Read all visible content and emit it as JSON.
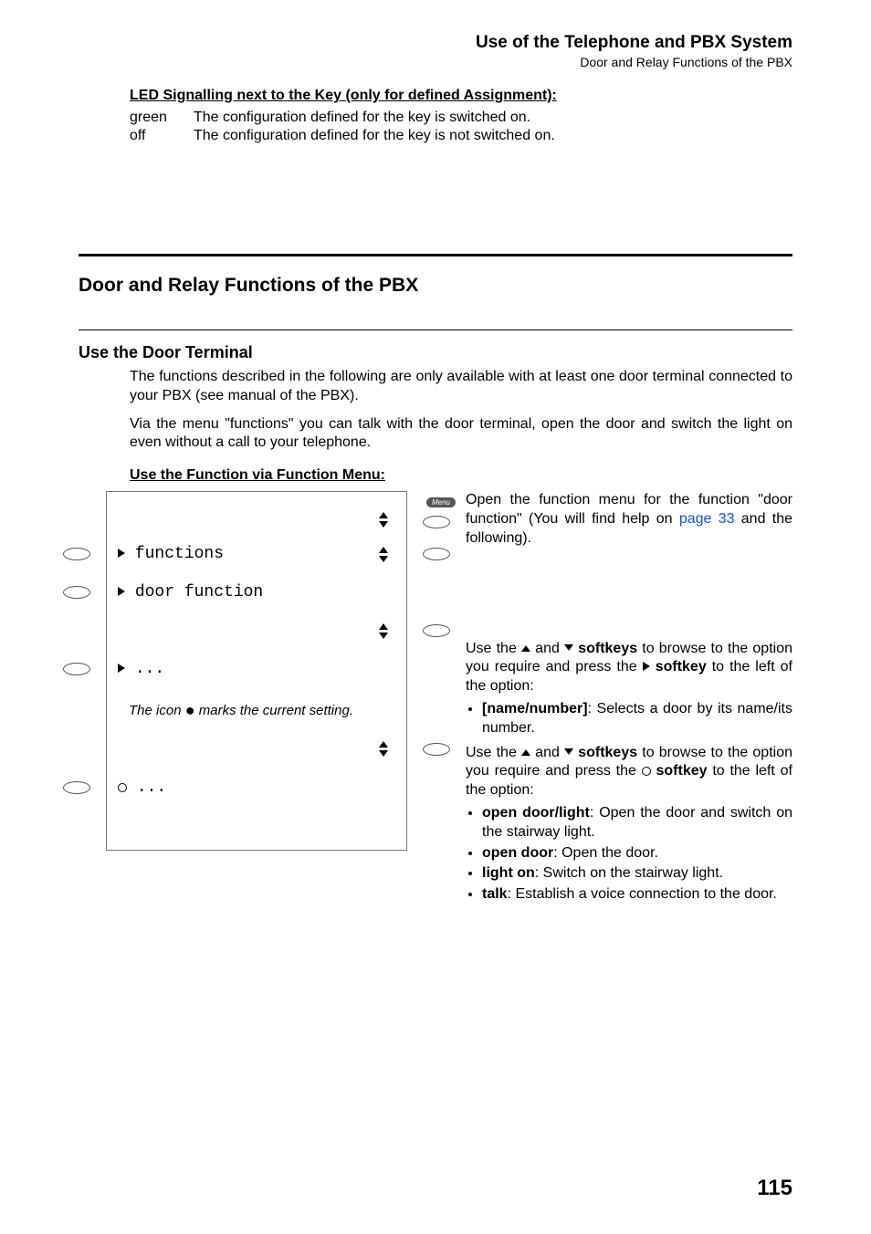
{
  "header": {
    "title": "Use of the Telephone and PBX System",
    "subtitle": "Door and Relay Functions of the PBX"
  },
  "led": {
    "heading": "LED Signalling next to the Key (only for defined Assignment):",
    "rows": [
      {
        "k": "green",
        "v": "The configuration defined for the key is switched on."
      },
      {
        "k": "off",
        "v": "The configuration defined for the key is not switched on."
      }
    ]
  },
  "h2": "Door and Relay Functions of the PBX",
  "h3": "Use the Door Terminal",
  "p1": "The functions described in the following are only available with at least one door terminal connected to your PBX (see manual of the PBX).",
  "p2": "Via the menu \"functions\" you can talk with the door terminal, open the door and switch the light on even without a call to your telephone.",
  "h4": "Use the Function via Function Menu:",
  "screen": {
    "menu_label": "Menu",
    "row_functions": "functions",
    "row_door_function": "door function",
    "row_select_tri": "...",
    "row_select_circle": "...",
    "note_prefix": "The icon ",
    "note_suffix": " marks the current setting."
  },
  "right": {
    "intro_a": "Open the function menu for the function \"door function\" (You will find help on ",
    "intro_link": "page 33",
    "intro_b": " and the following).",
    "browse1_a": "Use the ",
    "browse1_b": " and ",
    "browse1_c": " softkeys",
    "browse1_d": " to browse to the option you require and press the ",
    "browse1_e": " softkey",
    "browse1_f": " to the left of the option:",
    "bullets1": [
      {
        "bold": "[name/number]",
        "rest": ": Selects a door by its name/its number."
      }
    ],
    "browse2_a": "Use the ",
    "browse2_b": " and ",
    "browse2_c": " softkeys",
    "browse2_d": " to browse to the option you require and press the ",
    "browse2_e": " softkey",
    "browse2_f": " to the left of the option:",
    "bullets2": [
      {
        "bold": "open door/light",
        "rest": ": Open the door and switch on the stairway light."
      },
      {
        "bold": "open door",
        "rest": ": Open the door."
      },
      {
        "bold": "light on",
        "rest": ": Switch on the stairway light."
      },
      {
        "bold": "talk",
        "rest": ": Establish a voice connection to the door."
      }
    ]
  },
  "page_number": "115"
}
